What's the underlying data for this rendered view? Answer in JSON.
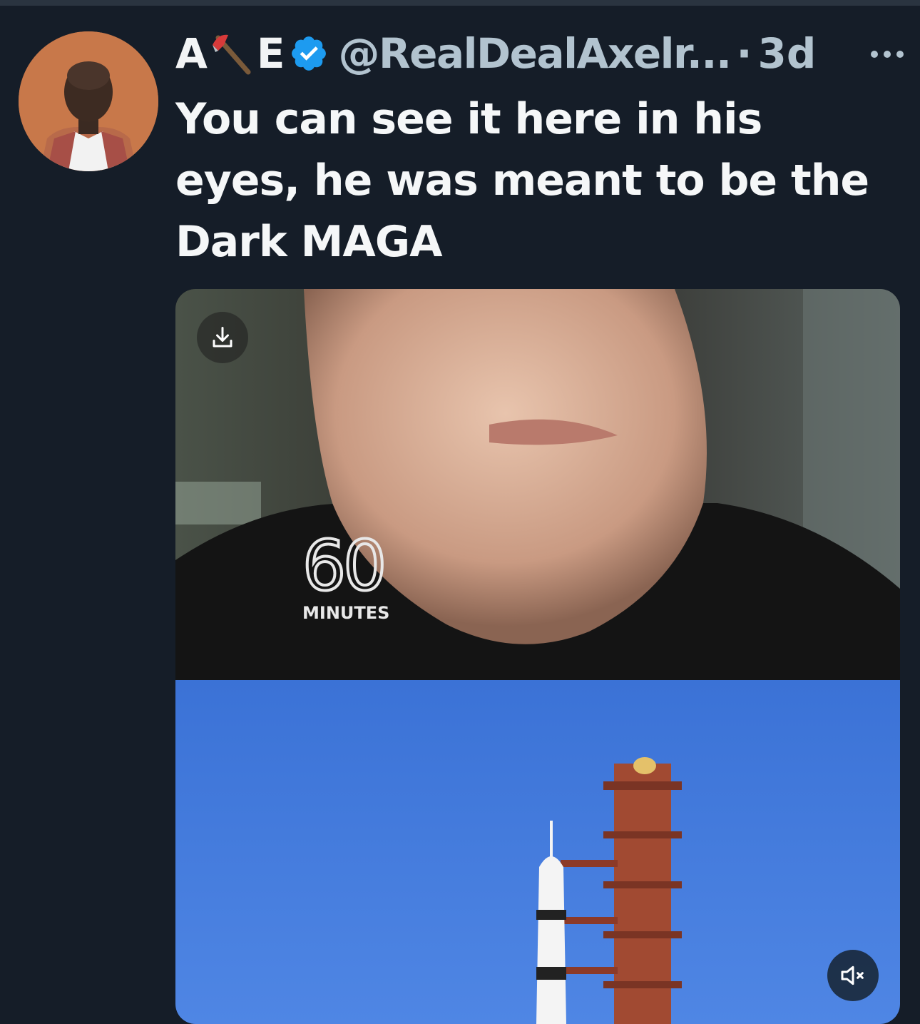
{
  "tweet": {
    "display_name_start": "A",
    "display_name_end": "E",
    "handle": "@RealDealAxelr...",
    "separator": "·",
    "timestamp": "3d",
    "text": "You can see it here in his eyes, he was meant to be the Dark MAGA"
  },
  "media": {
    "logo_number": "60",
    "logo_word": "MINUTES"
  },
  "icons": {
    "axe": "axe-icon",
    "verified": "verified-badge-icon",
    "more": "more-options-icon",
    "download": "download-icon",
    "mute": "volume-muted-icon"
  },
  "colors": {
    "background": "#151d28",
    "verified_blue": "#1d9bf0",
    "handle_gray": "#b2c3cf"
  }
}
